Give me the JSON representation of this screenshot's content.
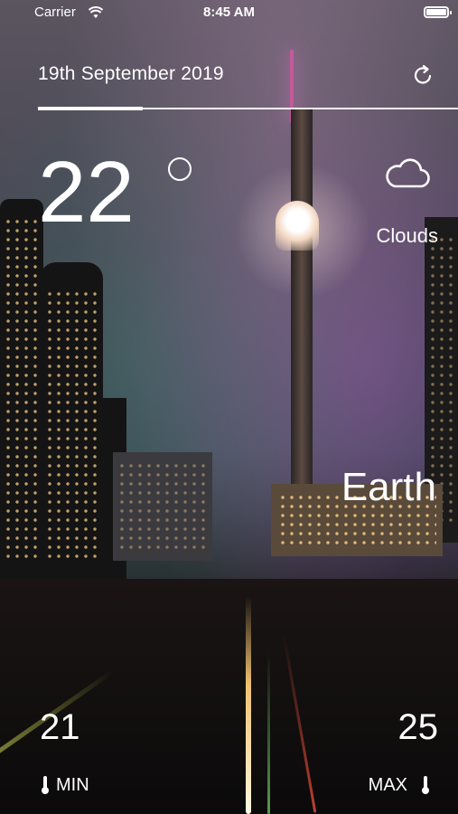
{
  "status_bar": {
    "carrier": "Carrier",
    "time": "8:45 AM",
    "wifi_icon": "wifi-icon",
    "battery_icon": "battery-icon"
  },
  "header": {
    "date": "19th September 2019",
    "refresh_icon": "refresh-icon",
    "progress_fraction": 0.25
  },
  "current": {
    "temperature": "22",
    "condition": "Clouds",
    "condition_icon": "cloud-icon"
  },
  "location": "Earth",
  "range": {
    "min_value": "21",
    "min_label": "MIN",
    "max_value": "25",
    "max_label": "MAX",
    "icon": "thermometer-icon"
  },
  "colors": {
    "text": "#ffffff"
  }
}
